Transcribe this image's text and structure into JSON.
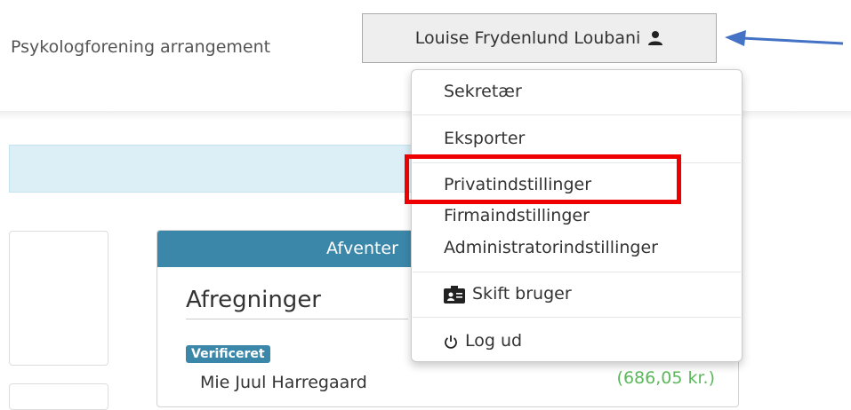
{
  "header": {
    "company_name": "Psykologforening arrangement",
    "user_name": "Louise Frydenlund Loubani"
  },
  "dropdown": {
    "items": [
      {
        "label": "Sekretær"
      },
      {
        "label": "Eksporter"
      },
      {
        "label": "Privatindstillinger"
      },
      {
        "label": "Firmaindstillinger"
      },
      {
        "label": "Administratorindstillinger"
      },
      {
        "label": "Skift bruger",
        "icon": "switch-user-icon"
      },
      {
        "label": "Log ud",
        "icon": "power-icon"
      }
    ]
  },
  "card": {
    "header_label": "Afventer",
    "title": "Afregninger",
    "badge": "Verificeret",
    "person": "Mie Juul Harregaard",
    "amount": "(686,05 kr.)"
  },
  "colors": {
    "accent": "#3b87aa",
    "highlight": "#ee0000",
    "arrow": "#4472c4",
    "amount": "#5cb85c"
  }
}
